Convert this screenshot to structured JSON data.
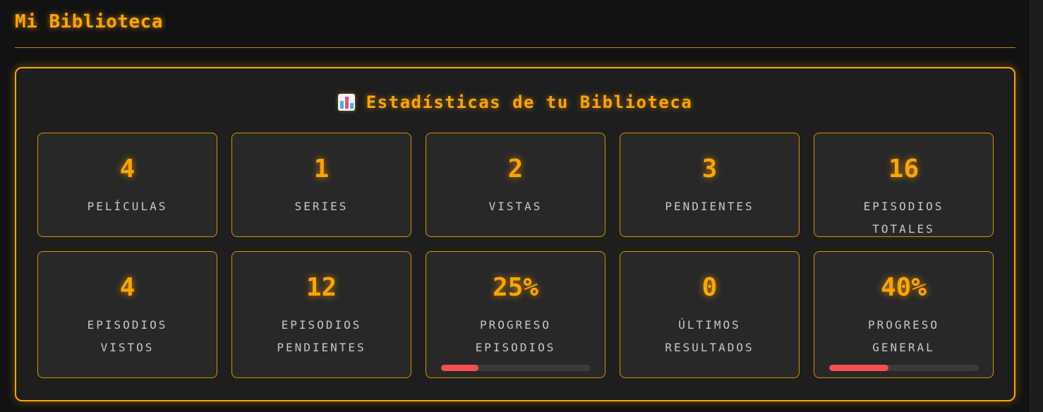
{
  "page": {
    "title": "Mi Biblioteca"
  },
  "stats": {
    "title": "Estadísticas de tu Biblioteca",
    "icon": "bar-chart-icon",
    "accent_color": "#ffa500",
    "progress_color": "#f45050",
    "cards": [
      {
        "value": "4",
        "label": "PELÍCULAS"
      },
      {
        "value": "1",
        "label": "SERIES"
      },
      {
        "value": "2",
        "label": "VISTAS"
      },
      {
        "value": "3",
        "label": "PENDIENTES"
      },
      {
        "value": "16",
        "label": "EPISODIOS TOTALES"
      },
      {
        "value": "4",
        "label": "EPISODIOS VISTOS"
      },
      {
        "value": "12",
        "label": "EPISODIOS PENDIENTES"
      },
      {
        "value": "25%",
        "label": "PROGRESO EPISODIOS",
        "progress": 0.25
      },
      {
        "value": "0",
        "label": "ÚLTIMOS RESULTADOS"
      },
      {
        "value": "40%",
        "label": "PROGRESO GENERAL",
        "progress": 0.4
      }
    ]
  }
}
